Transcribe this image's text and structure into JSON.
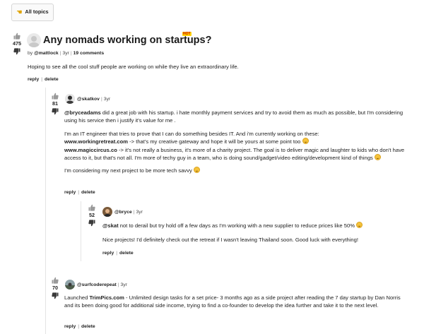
{
  "header": {
    "all_topics_label": "All topics",
    "all_topics_icon": "pointing-hand-icon"
  },
  "post": {
    "votes": "475",
    "title": "Any nomads working on startups?",
    "hot_badge": "HOT",
    "by_label": "by",
    "author": "@mattlock",
    "age": "3yr",
    "comments": "19 comments",
    "body": "Hoping to see all the cool stuff people are working on while they live an extraordinary life.",
    "reply_label": "reply",
    "delete_label": "delete"
  },
  "comments": [
    {
      "votes": "81",
      "author": "@skatkov",
      "age": "3yr",
      "mention": "@bryceadams",
      "p1": " did a great job with his startup. i hate monthly payment services and try to avoid them as much as possible, but I'm considering using his service then i justify it's value for me .",
      "p2_intro": "I'm an IT engineer that tries to prove that I can do something besides IT. And i'm currently working on these:",
      "link1": "www.workingretreat.com",
      "link1_desc": " -> that's my creative gateway and hope it will be yours at some point too",
      "link2": "www.magiccircus.co",
      "link2_desc": " -> it's not really a business, it's more of a charity project. The goal is to deliver magic and laughter to kids who don't have access to it, but that's not all. I'm more of techy guy in a team, who is doing sound/gadget/video editing/development kind of things",
      "p3": "I'm considering my next project to be more tech savvy",
      "reply_label": "reply",
      "delete_label": "delete"
    },
    {
      "votes": "52",
      "author": "@bryce",
      "age": "3yr",
      "mention": "@skat",
      "p1": " not to derail but try hold off a few days as I'm working with a new supplier to reduce prices like 50%",
      "p2": "Nice projects! I'd definitely check out the retreat if I wasn't leaving Thailand soon. Good luck with everything!",
      "reply_label": "reply",
      "delete_label": "delete"
    },
    {
      "votes": "70",
      "author": "@surfcoderepeat",
      "age": "3yr",
      "p1_start": "Launched ",
      "link": "TrimPics.com",
      "p1_rest": " - Unlimited design tasks for a set price- 3 months ago as a side project after reading the 7 day startup by Dan Norris and its been doing good for additional side income, trying to find a co-founder to develop the idea further and take it to the next level.",
      "reply_label": "reply",
      "delete_label": "delete"
    }
  ],
  "colors": {
    "accent_hot": "#ffd400",
    "text": "#222222",
    "border": "#d6d6d6"
  }
}
